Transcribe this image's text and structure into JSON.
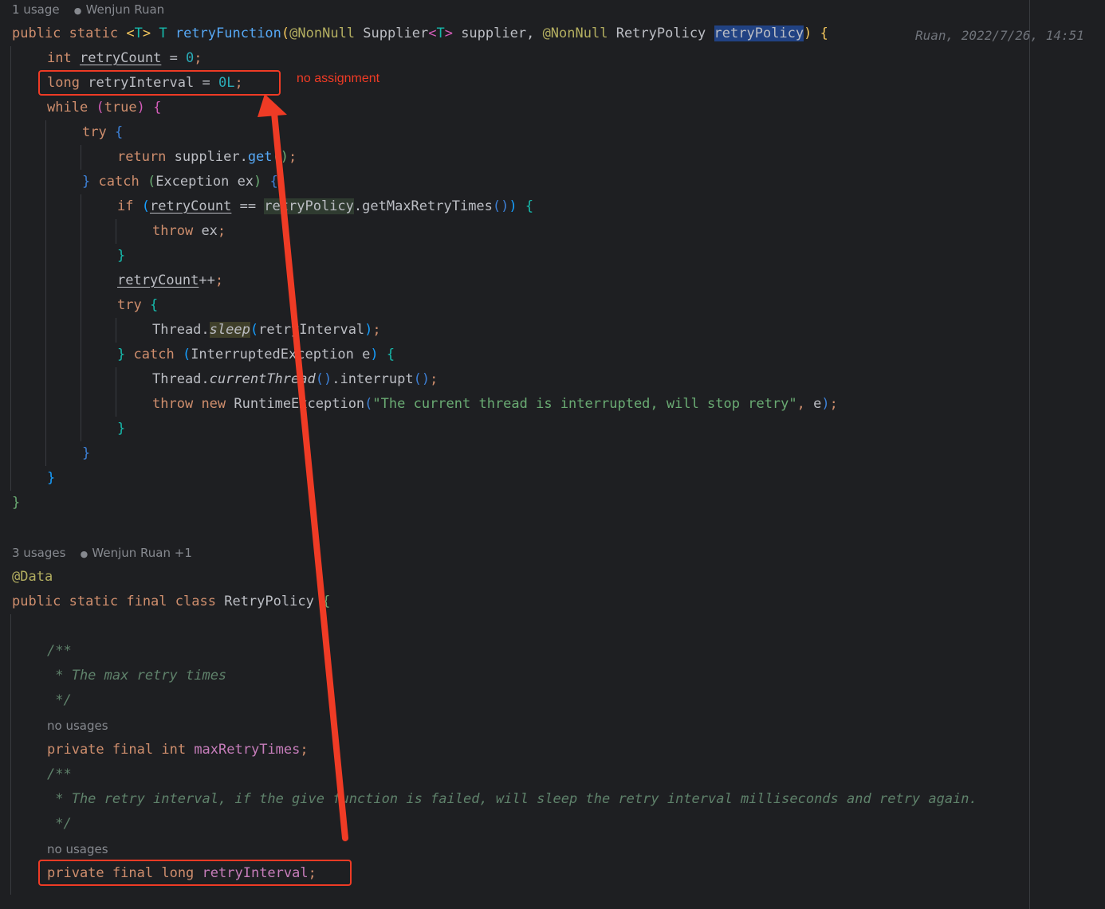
{
  "hints": {
    "method_usages": "1 usage",
    "method_author": "Wenjun Ruan",
    "class_usages": "3 usages",
    "class_author": "Wenjun Ruan +1",
    "field1_usages": "no usages",
    "field2_usages": "no usages",
    "person_icon": "person-icon"
  },
  "blame": "Ruan, 2022/7/26, 14:51",
  "annotation_note": "no assignment",
  "annotation_color": "#ef3b25",
  "code": {
    "t_public": "public",
    "t_static": "static",
    "t_final": "final",
    "t_class": "class",
    "t_private": "private",
    "t_int": "int",
    "t_long": "long",
    "t_while": "while",
    "t_true": "true",
    "t_try": "try",
    "t_return": "return",
    "t_catch": "catch",
    "t_if": "if",
    "t_throw": "throw",
    "t_new": "new",
    "t_type_T": "T",
    "t_retryFunction": "retryFunction",
    "t_nonnull": "@NonNull",
    "t_supplier_type": "Supplier",
    "t_supplier": "supplier",
    "t_retrypolicy_type": "RetryPolicy",
    "t_retrypolicy": "retryPolicy",
    "t_retryCount": "retryCount",
    "t_retryInterval": "retryInterval",
    "t_zero": "0",
    "t_zeroL": "0L",
    "t_get": "get",
    "t_exception": "Exception",
    "t_ex": "ex",
    "t_getMaxRetryTimes": "getMaxRetryTimes",
    "t_thread": "Thread",
    "t_sleep": "sleep",
    "t_interrupted_exception": "InterruptedException",
    "t_e": "e",
    "t_currentThread": "currentThread",
    "t_interrupt": "interrupt",
    "t_runtime_exception": "RuntimeException",
    "t_message": "\"The current thread is interrupted, will stop retry\"",
    "t_data": "@Data",
    "t_maxRetryTimes": "maxRetryTimes",
    "c_open": "/**",
    "c_max": " * The max retry times",
    "c_close": " */",
    "c_interval": " * The retry interval, if the give function is failed, will sleep the retry interval milliseconds and retry again.",
    "p_sp": " ",
    "p_lt": "<",
    "p_gt": ">",
    "p_lp": "(",
    "p_rp": ")",
    "p_lb": "{",
    "p_rb": "}",
    "p_semi": ";",
    "p_comma": ", ",
    "p_dot": ".",
    "p_eq": " = ",
    "p_eqeq": " == ",
    "p_inc": "++",
    "p_call": "()"
  }
}
